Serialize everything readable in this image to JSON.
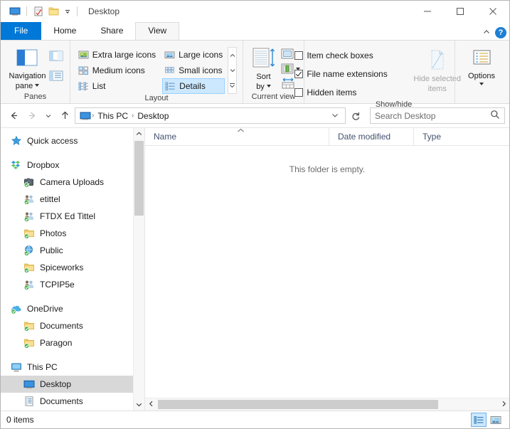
{
  "window": {
    "title": "Desktop",
    "quick_access_toolbar": [
      {
        "name": "desktop-icon",
        "tooltip": "Desktop"
      },
      {
        "name": "properties-icon",
        "tooltip": "Properties"
      },
      {
        "name": "new-folder-icon",
        "tooltip": "New folder"
      },
      {
        "name": "chevron-down-icon",
        "tooltip": "Customize Quick Access Toolbar"
      }
    ],
    "controls": {
      "minimize": "—",
      "maximize": "□",
      "close": "✕"
    }
  },
  "tabs": [
    {
      "label": "File",
      "active": false,
      "style": "file"
    },
    {
      "label": "Home",
      "active": false
    },
    {
      "label": "Share",
      "active": false
    },
    {
      "label": "View",
      "active": true
    }
  ],
  "tab_right": {
    "collapse_icon": "^",
    "help_label": "?"
  },
  "ribbon": {
    "groups": [
      {
        "label": "Panes",
        "big_buttons": [
          {
            "label": "Navigation\npane",
            "line1": "Navigation",
            "line2": "pane",
            "has_caret": true,
            "disabled": false
          }
        ],
        "small_buttons": [
          {
            "label": "",
            "name": "preview-pane-button"
          },
          {
            "label": "",
            "name": "details-pane-button"
          }
        ]
      },
      {
        "label": "Layout",
        "items": [
          {
            "label": "Extra large icons",
            "selected": false
          },
          {
            "label": "Large icons",
            "selected": false
          },
          {
            "label": "Medium icons",
            "selected": false
          },
          {
            "label": "Small icons",
            "selected": false
          },
          {
            "label": "List",
            "selected": false
          },
          {
            "label": "Details",
            "selected": true
          }
        ],
        "scroll": {
          "up": "▲",
          "down": "▼",
          "more": "☰"
        }
      },
      {
        "label": "Current view",
        "big_buttons": [
          {
            "line1": "Sort",
            "line2": "by",
            "has_caret": true,
            "disabled": false
          }
        ],
        "small_buttons": [
          {
            "name": "add-columns-button",
            "has_caret": true
          },
          {
            "name": "column-chart-button",
            "has_caret": true
          },
          {
            "name": "size-all-columns-button",
            "has_caret": false
          }
        ]
      },
      {
        "label": "Show/hide",
        "checkboxes": [
          {
            "label": "Item check boxes",
            "checked": false
          },
          {
            "label": "File name extensions",
            "checked": true
          },
          {
            "label": "Hidden items",
            "checked": false
          }
        ],
        "big_buttons": [
          {
            "line1": "Hide selected",
            "line2": "items",
            "disabled": true,
            "has_caret": false
          }
        ]
      },
      {
        "label": "",
        "big_buttons": [
          {
            "line1": "Options",
            "line2": "",
            "has_caret": true,
            "disabled": false
          }
        ]
      }
    ]
  },
  "addressbar": {
    "back": "←",
    "forward": "→",
    "recent": "⌄",
    "up": "↑",
    "breadcrumbs": [
      "This PC",
      "Desktop"
    ],
    "separator": "›",
    "dropdown": "⌄",
    "refresh": "↻",
    "search_placeholder": "Search Desktop",
    "search_value": ""
  },
  "navpane": {
    "items": [
      {
        "label": "Quick access",
        "icon": "star-icon",
        "level": 1,
        "selected": false,
        "gap_after": true
      },
      {
        "label": "Dropbox",
        "icon": "dropbox-icon",
        "level": 1,
        "selected": false
      },
      {
        "label": "Camera Uploads",
        "icon": "camera-folder-icon",
        "level": 2,
        "selected": false
      },
      {
        "label": "etittel",
        "icon": "shared-folder-icon",
        "level": 2,
        "selected": false
      },
      {
        "label": "FTDX Ed Tittel",
        "icon": "shared-folder-icon",
        "level": 2,
        "selected": false
      },
      {
        "label": "Photos",
        "icon": "folder-sync-icon",
        "level": 2,
        "selected": false
      },
      {
        "label": "Public",
        "icon": "globe-folder-icon",
        "level": 2,
        "selected": false
      },
      {
        "label": "Spiceworks",
        "icon": "folder-sync-icon",
        "level": 2,
        "selected": false
      },
      {
        "label": "TCPIP5e",
        "icon": "shared-folder-icon",
        "level": 2,
        "selected": false,
        "gap_after": true
      },
      {
        "label": "OneDrive",
        "icon": "onedrive-icon",
        "level": 1,
        "selected": false
      },
      {
        "label": "Documents",
        "icon": "folder-sync-icon",
        "level": 2,
        "selected": false
      },
      {
        "label": "Paragon",
        "icon": "folder-sync-icon",
        "level": 2,
        "selected": false,
        "gap_after": true
      },
      {
        "label": "This PC",
        "icon": "computer-icon",
        "level": 1,
        "selected": false
      },
      {
        "label": "Desktop",
        "icon": "desktop-icon",
        "level": 2,
        "selected": true
      },
      {
        "label": "Documents",
        "icon": "documents-icon",
        "level": 2,
        "selected": false
      }
    ],
    "scroll": {
      "up": "∧",
      "down": "∨"
    }
  },
  "filelist": {
    "columns": [
      {
        "label": "Name",
        "sorted": true,
        "sort_dir": "asc"
      },
      {
        "label": "Date modified",
        "sorted": false
      },
      {
        "label": "Type",
        "sorted": false
      }
    ],
    "rows": [],
    "empty_message": "This folder is empty.",
    "hscroll": {
      "left": "‹",
      "right": "›"
    }
  },
  "status": {
    "item_count": "0 items",
    "view_buttons": [
      {
        "name": "details-view-button",
        "active": true
      },
      {
        "name": "large-icons-view-button",
        "active": false
      }
    ]
  },
  "colors": {
    "accent": "#0078d7",
    "selection": "#cce8ff",
    "nav_selection": "#d8d8d8",
    "ribbon_bg": "#f7f7f7",
    "header_text": "#42526e"
  }
}
